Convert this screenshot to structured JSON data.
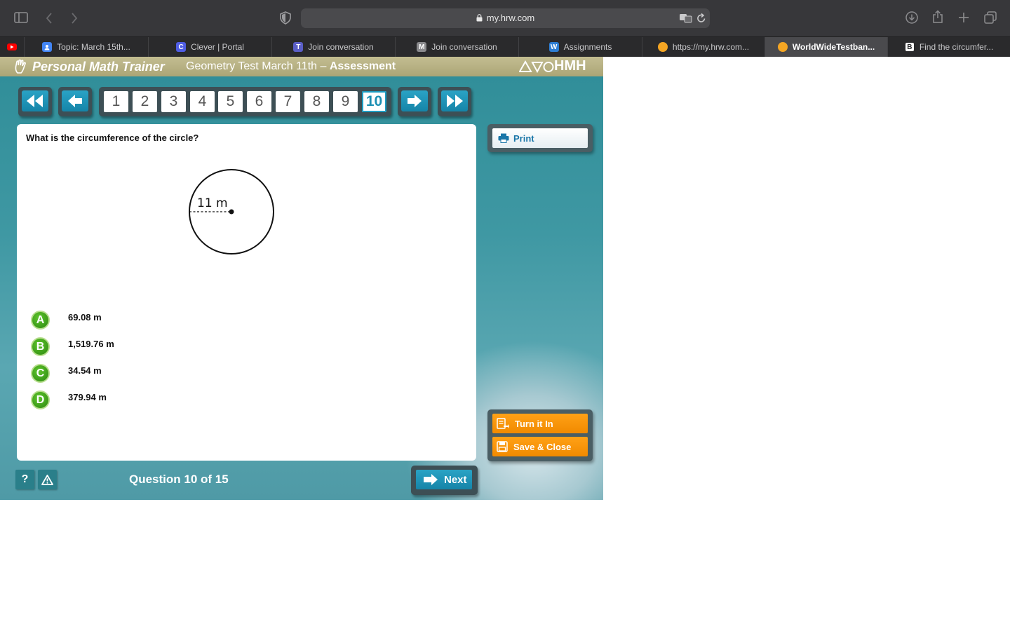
{
  "browser": {
    "url": "my.hrw.com",
    "tabs": [
      {
        "label": "",
        "icon": "youtube-icon",
        "color": "#ff0000"
      },
      {
        "label": "Topic: March 15th...",
        "icon": "classroom-icon",
        "color": "#4285f4"
      },
      {
        "label": "Clever | Portal",
        "icon": "clever-icon",
        "color": "#4f5de4",
        "icon_text": "C"
      },
      {
        "label": "Join conversation",
        "icon": "teams-icon",
        "color": "#5b5fc7"
      },
      {
        "label": "Join conversation",
        "icon": "m-icon",
        "color": "#8a8a8d",
        "icon_text": "M"
      },
      {
        "label": "Assignments",
        "icon": "w-icon",
        "color": "#2d7dd2",
        "icon_text": "W"
      },
      {
        "label": "https://my.hrw.com...",
        "icon": "dot-icon",
        "color": "#f5a623"
      },
      {
        "label": "WorldWideTestban...",
        "icon": "dot-icon",
        "color": "#f5a623",
        "active": true
      },
      {
        "label": "Find the circumfer...",
        "icon": "b-icon",
        "color": "#ffffff",
        "icon_text": "B"
      }
    ]
  },
  "app": {
    "brand": "Personal Math Trainer",
    "test_name": "Geometry Test March 11th –",
    "test_mode": "Assessment",
    "publisher": "HMH"
  },
  "nav": {
    "questions": [
      "1",
      "2",
      "3",
      "4",
      "5",
      "6",
      "7",
      "8",
      "9",
      "10"
    ],
    "current": "10"
  },
  "question": {
    "prompt": "What is the circumference of the circle?",
    "figure_label": "11 m",
    "choices": [
      {
        "letter": "A",
        "text": "69.08 m"
      },
      {
        "letter": "B",
        "text": "1,519.76 m"
      },
      {
        "letter": "C",
        "text": "34.54 m"
      },
      {
        "letter": "D",
        "text": "379.94 m"
      }
    ]
  },
  "side": {
    "print": "Print",
    "turn_in": "Turn it In",
    "save_close": "Save & Close"
  },
  "footer": {
    "help": "?",
    "alert": "⚠",
    "question_count": "Question 10 of 15",
    "next": "Next"
  },
  "colors": {
    "accent_blue": "#1c8fb3",
    "orange": "#f18a00",
    "choice_green": "#3a9a18"
  }
}
